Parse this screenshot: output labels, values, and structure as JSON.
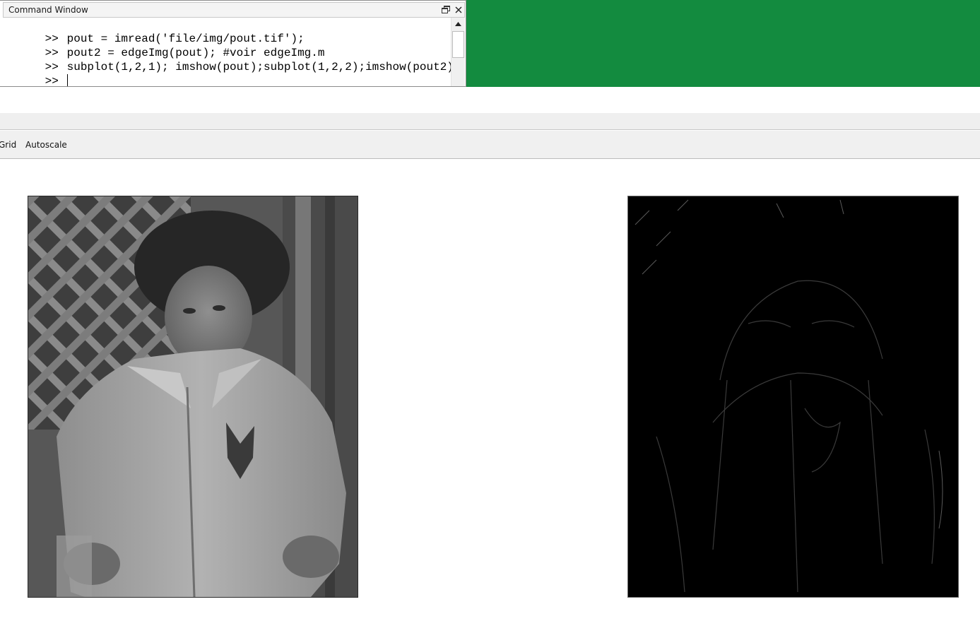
{
  "command_window": {
    "title": "Command Window",
    "lines": [
      {
        "prompt": ">>",
        "code": "pout = imread('file/img/pout.tif');"
      },
      {
        "prompt": ">>",
        "code": "pout2 = edgeImg(pout); #voir edgeImg.m"
      },
      {
        "prompt": ">>",
        "code": "subplot(1,2,1); imshow(pout);subplot(1,2,2);imshow(pout2);"
      },
      {
        "prompt": ">>",
        "code": ""
      }
    ],
    "icons": {
      "undock": "undock-icon",
      "close": "close-icon",
      "scroll_up": "scroll-up-arrow-icon"
    }
  },
  "figure": {
    "menu": {
      "grid_label": "Grid",
      "autoscale_label": "Autoscale"
    },
    "subplots": [
      {
        "content": "grayscale photograph (original pout image)"
      },
      {
        "content": "edge-detected image on black background"
      }
    ]
  },
  "colors": {
    "desktop_green": "#138b3f",
    "edge_background": "#000000"
  }
}
